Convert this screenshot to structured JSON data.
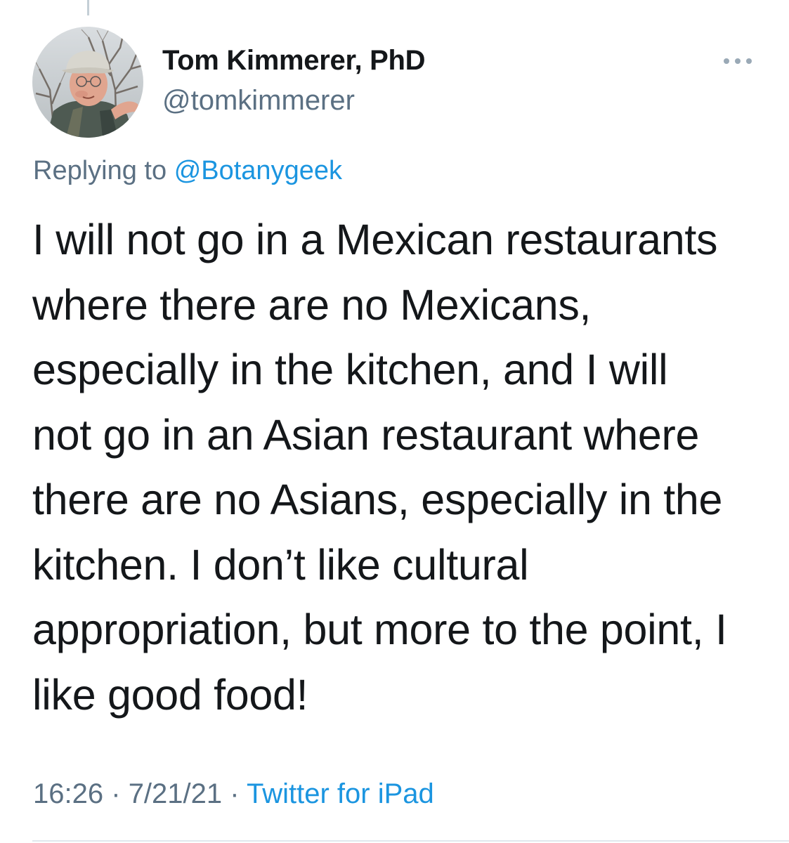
{
  "tweet": {
    "author": {
      "display_name": "Tom Kimmerer, PhD",
      "handle": "@tomkimmerer",
      "avatar_icon": "profile-photo"
    },
    "replying_to": {
      "prefix": "Replying to",
      "handle": "@Botanygeek"
    },
    "text_lines": [
      "I will not go in a Mexican restaurants",
      "where there are no Mexicans,",
      "especially in the kitchen, and I will",
      "not go in an Asian restaurant where",
      "there are no Asians, especially in the",
      "kitchen. I don’t like cultural",
      "appropriation, but more to the point, I",
      "like good food!"
    ],
    "meta": {
      "time": "16:26",
      "separator": "·",
      "date": "7/21/21",
      "source": "Twitter for iPad"
    },
    "more_icon": "more-horizontal-icon"
  },
  "colors": {
    "text_primary": "#14171a",
    "text_secondary": "#5b7083",
    "link": "#1b95e0",
    "divider": "#e1e8ed"
  }
}
